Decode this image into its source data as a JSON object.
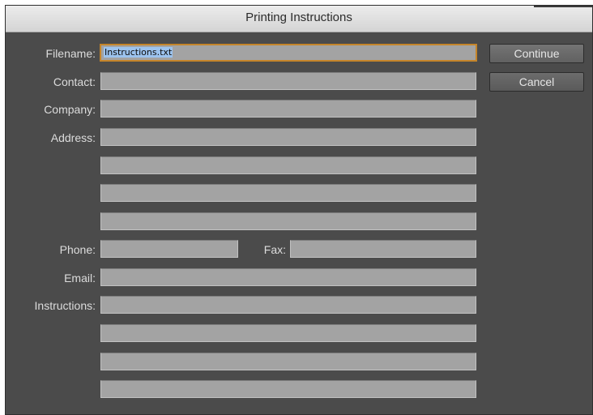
{
  "dialog": {
    "title": "Printing Instructions"
  },
  "fields": {
    "filename": {
      "label": "Filename:",
      "value": "Instructions.txt"
    },
    "contact": {
      "label": "Contact:",
      "value": ""
    },
    "company": {
      "label": "Company:",
      "value": ""
    },
    "address": {
      "label": "Address:",
      "lines": [
        "",
        "",
        "",
        ""
      ]
    },
    "phone": {
      "label": "Phone:",
      "value": ""
    },
    "fax": {
      "label": "Fax:",
      "value": ""
    },
    "email": {
      "label": "Email:",
      "value": ""
    },
    "instructions": {
      "label": "Instructions:",
      "lines": [
        "",
        "",
        "",
        ""
      ]
    }
  },
  "buttons": {
    "continue_label": "Continue",
    "cancel_label": "Cancel"
  },
  "colors": {
    "dialog_bg": "#4b4b4b",
    "field_bg": "#a3a3a3",
    "focus_ring": "#c5852a",
    "selection": "#9cc3ee"
  }
}
